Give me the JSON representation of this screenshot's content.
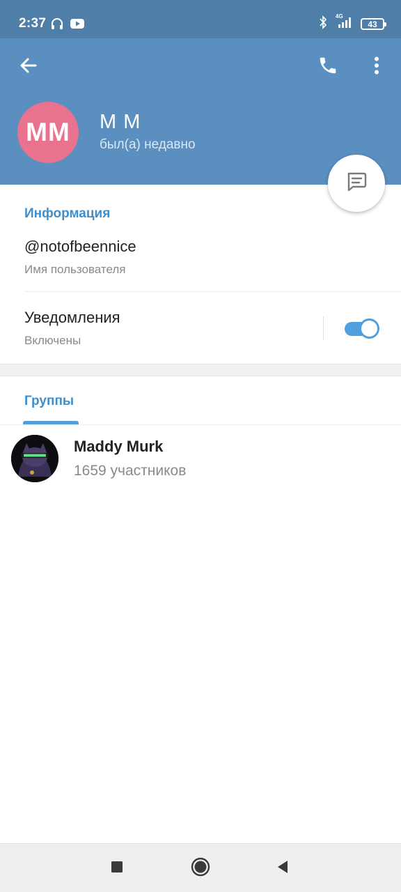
{
  "status_bar": {
    "time": "2:37",
    "network": "4G",
    "battery": "43",
    "icons": [
      "headphones-icon",
      "youtube-icon",
      "bluetooth-icon",
      "signal-icon",
      "battery-icon"
    ]
  },
  "header": {
    "avatar_initials": "MM",
    "name": "M M",
    "status": "был(а) недавно",
    "icons": [
      "back-arrow-icon",
      "phone-icon",
      "more-vertical-icon",
      "message-icon"
    ]
  },
  "info": {
    "title": "Информация",
    "username": "@notofbeennice",
    "username_label": "Имя пользователя",
    "notifications_label": "Уведомления",
    "notifications_state": "Включены",
    "notifications_on": true
  },
  "groups": {
    "title": "Группы",
    "items": [
      {
        "name": "Maddy Murk",
        "members": "1659 участников"
      }
    ]
  },
  "navbar": {
    "icons": [
      "recents-square-icon",
      "home-circle-icon",
      "back-triangle-icon"
    ]
  },
  "colors": {
    "status_bar": "#4f7fa8",
    "header": "#5b8fc0",
    "avatar": "#e9728f",
    "accent": "#3e8fcc",
    "toggle": "#4fa0dd"
  }
}
